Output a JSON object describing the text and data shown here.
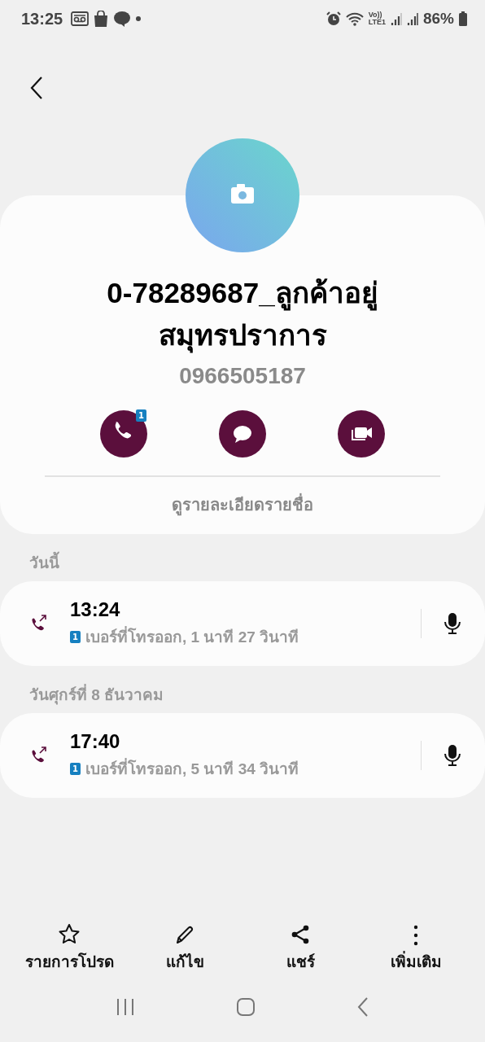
{
  "status_bar": {
    "time": "13:25",
    "network_label": [
      "Vo))",
      "LTE1"
    ],
    "battery": "86%"
  },
  "contact": {
    "name": "0-78289687_ลูกค้าอยู่สมุทรปราการ",
    "phone": "0966505187",
    "sim_badge": "1"
  },
  "actions": [
    {
      "kind": "call"
    },
    {
      "kind": "message"
    },
    {
      "kind": "video"
    }
  ],
  "details_link": "ดูรายละเอียดรายชื่อ",
  "call_groups": [
    {
      "date": "วันนี้",
      "calls": [
        {
          "kind": "outgoing",
          "time": "13:24",
          "sim": "1",
          "description": "เบอร์ที่โทรออก, 1 นาที 27 วินาที"
        }
      ]
    },
    {
      "date": "วันศุกร์ที่ 8 ธันวาคม",
      "calls": [
        {
          "kind": "outgoing",
          "time": "17:40",
          "sim": "1",
          "description": "เบอร์ที่โทรออก, 5 นาที 34 วินาที"
        }
      ]
    }
  ],
  "bottom_actions": [
    {
      "kind": "star",
      "label": "รายการโปรด"
    },
    {
      "kind": "edit",
      "label": "แก้ไข"
    },
    {
      "kind": "share",
      "label": "แชร์"
    },
    {
      "kind": "more",
      "label": "เพิ่มเติม"
    }
  ]
}
